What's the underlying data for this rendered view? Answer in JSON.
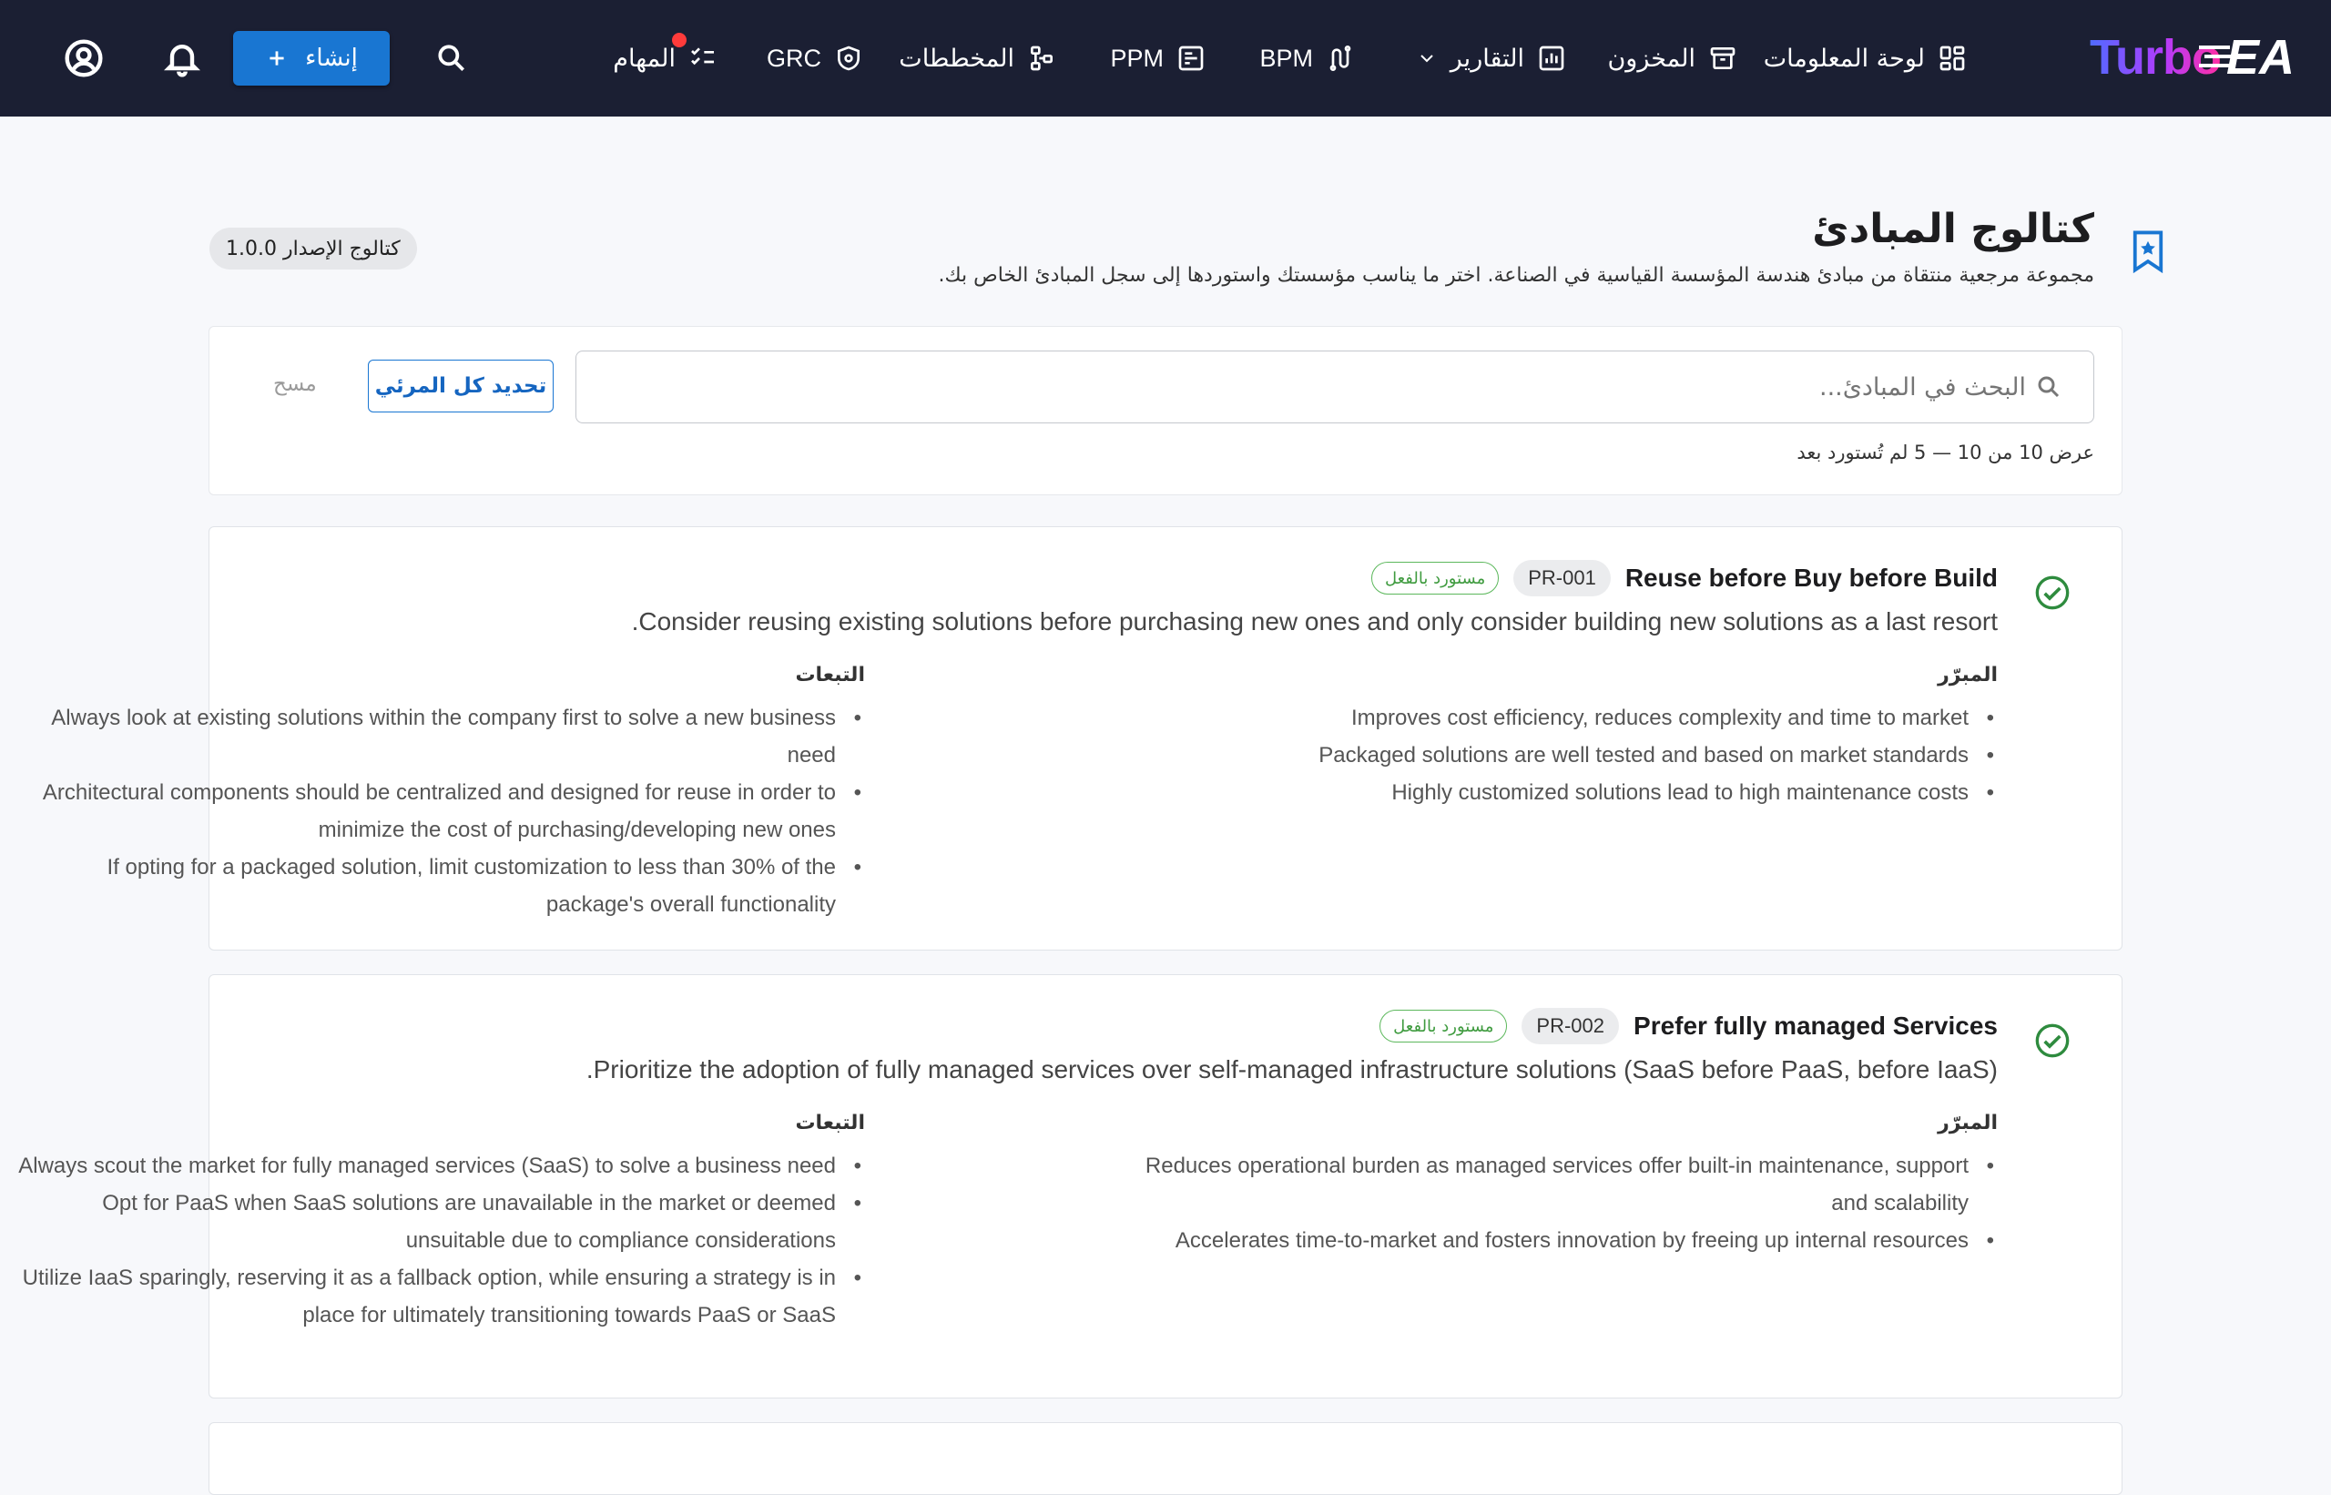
{
  "topbar": {
    "brand": {
      "text": "Turbo",
      "suffix": "EA"
    },
    "nav": [
      {
        "label": "لوحة المعلومات",
        "icon": "dashboard-icon"
      },
      {
        "label": "المخزون",
        "icon": "inventory-icon"
      },
      {
        "label": "التقارير",
        "icon": "reports-icon",
        "has_dropdown": true
      },
      {
        "label": "BPM",
        "icon": "bpm-icon"
      },
      {
        "label": "PPM",
        "icon": "ppm-icon"
      },
      {
        "label": "المخططات",
        "icon": "diagrams-icon"
      },
      {
        "label": "GRC",
        "icon": "shield-icon"
      },
      {
        "label": "المهام",
        "icon": "tasks-icon",
        "has_notification": true
      }
    ],
    "search_icon": "search-icon",
    "create_button": {
      "label": "إنشاء",
      "icon": "plus-icon"
    },
    "bell_icon": "bell-icon",
    "account_icon": "account-icon"
  },
  "header": {
    "title": "كتالوج المبادئ",
    "subtitle": "مجموعة مرجعية منتقاة من مبادئ هندسة المؤسسة القياسية في الصناعة. اختر ما يناسب مؤسستك واستوردها إلى سجل المبادئ الخاص بك.",
    "version_chip": "كتالوج الإصدار 1.0.0"
  },
  "search": {
    "placeholder": "البحث في المبادئ...",
    "select_all_label": "تحديد كل المرئي",
    "clear_label": "مسح",
    "count_text": "عرض 10 من 10 — 5 لم تُستورد بعد"
  },
  "labels": {
    "rationale": "المبرّر",
    "implications": "التبعات",
    "imported": "مستورد بالفعل"
  },
  "colors": {
    "topbar_bg": "#1b1f33",
    "primary": "#1976d2",
    "success": "#3f9b3f"
  },
  "principles": [
    {
      "code": "PR-001",
      "title": "Reuse before Buy before Build",
      "status": "مستورد بالفعل",
      "description": "Consider reusing existing solutions before purchasing new ones and only consider building new solutions as a last resort.",
      "rationale": [
        "Improves cost efficiency, reduces complexity and time to market",
        "Packaged solutions are well tested and based on market standards",
        "Highly customized solutions lead to high maintenance costs"
      ],
      "implications": [
        "Always look at existing solutions within the company first to solve a new business need",
        "Architectural components should be centralized and designed for reuse in order to minimize the cost of purchasing/developing new ones",
        "If opting for a packaged solution, limit customization to less than 30% of the package's overall functionality"
      ]
    },
    {
      "code": "PR-002",
      "title": "Prefer fully managed Services",
      "status": "مستورد بالفعل",
      "description": "Prioritize the adoption of fully managed services over self-managed infrastructure solutions (SaaS before PaaS, before IaaS).",
      "rationale": [
        "Reduces operational burden as managed services offer built-in maintenance, support and scalability",
        "Accelerates time-to-market and fosters innovation by freeing up internal resources"
      ],
      "implications": [
        "Always scout the market for fully managed services (SaaS) to solve a business need",
        "Opt for PaaS when SaaS solutions are unavailable in the market or deemed unsuitable due to compliance considerations",
        "Utilize IaaS sparingly, reserving it as a fallback option, while ensuring a strategy is in place for ultimately transitioning towards PaaS or SaaS"
      ]
    }
  ]
}
